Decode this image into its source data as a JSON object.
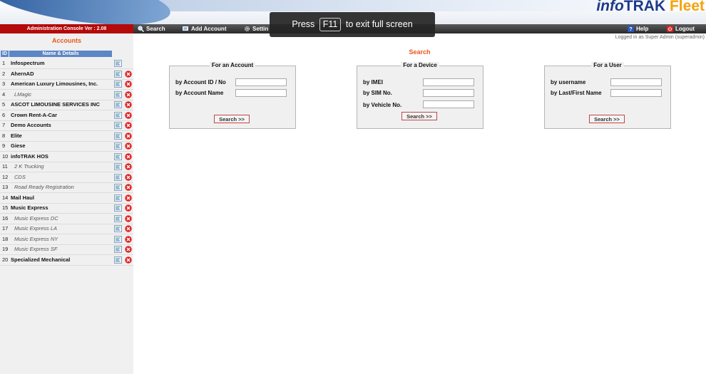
{
  "header": {
    "logo_prefix": "info",
    "logo_brand": "TRAK",
    "logo_suffix": "Fleet"
  },
  "toast": {
    "text_before": "Press",
    "key": "F11",
    "text_after": "to exit full screen"
  },
  "toolbar": {
    "console_version": "Administration Console Ver : 2.08",
    "search_label": "Search",
    "add_account_label": "Add Account",
    "settings_label": "Settin",
    "help_label": "Help",
    "logout_label": "Logout"
  },
  "sidebar": {
    "title": "Accounts",
    "col_id": "ID",
    "col_name": "Name & Details",
    "accounts": [
      {
        "id": "1",
        "name": "Infospectrum",
        "child": false,
        "deletable": false
      },
      {
        "id": "2",
        "name": "AhernAD",
        "child": false,
        "deletable": true
      },
      {
        "id": "3",
        "name": "American Luxury Limousines, Inc.",
        "child": false,
        "deletable": true
      },
      {
        "id": "4",
        "name": "LMagic",
        "child": true,
        "deletable": true
      },
      {
        "id": "5",
        "name": "ASCOT LIMOUSINE SERVICES INC",
        "child": false,
        "deletable": true
      },
      {
        "id": "6",
        "name": "Crown Rent-A-Car",
        "child": false,
        "deletable": true
      },
      {
        "id": "7",
        "name": "Demo Accounts",
        "child": false,
        "deletable": true
      },
      {
        "id": "8",
        "name": "Elite",
        "child": false,
        "deletable": true
      },
      {
        "id": "9",
        "name": "Giese",
        "child": false,
        "deletable": true
      },
      {
        "id": "10",
        "name": "infoTRAK HOS",
        "child": false,
        "deletable": true
      },
      {
        "id": "11",
        "name": "2 K Trucking",
        "child": true,
        "deletable": true
      },
      {
        "id": "12",
        "name": "CDS",
        "child": true,
        "deletable": true
      },
      {
        "id": "13",
        "name": "Road Ready Registration",
        "child": true,
        "deletable": true
      },
      {
        "id": "14",
        "name": "Mail Haul",
        "child": false,
        "deletable": true
      },
      {
        "id": "15",
        "name": "Music Express",
        "child": false,
        "deletable": true
      },
      {
        "id": "16",
        "name": "Music Express DC",
        "child": true,
        "deletable": true
      },
      {
        "id": "17",
        "name": "Music Express LA",
        "child": true,
        "deletable": true
      },
      {
        "id": "18",
        "name": "Music Express NY",
        "child": true,
        "deletable": true
      },
      {
        "id": "19",
        "name": "Music Express SF",
        "child": true,
        "deletable": true
      },
      {
        "id": "20",
        "name": "Specialized Mechanical",
        "child": false,
        "deletable": true
      }
    ]
  },
  "main": {
    "logged_in": "Logged in as Super Admin  (superadmin)",
    "search_title": "Search",
    "account_panel": {
      "title": "For an Account",
      "id_label": "by Account ID / No",
      "id_value": "",
      "name_label": "by Account Name",
      "name_value": "",
      "button": "Search >>"
    },
    "device_panel": {
      "title": "For a Device",
      "imei_label": "by IMEI",
      "imei_value": "",
      "sim_label": "by SIM No.",
      "sim_value": "",
      "vehicle_label": "by Vehicle No.",
      "vehicle_value": "",
      "button": "Search >>"
    },
    "user_panel": {
      "title": "For a User",
      "username_label": "by username",
      "username_value": "",
      "lastfirst_label": "by Last/First Name",
      "lastfirst_value": "",
      "button": "Search >>"
    }
  },
  "colors": {
    "accent_orange": "#e8581a",
    "console_red": "#b40a0a",
    "header_blue": "#5d86c6",
    "logo_blue": "#1d3a8a",
    "logo_orange": "#f5a20a"
  }
}
